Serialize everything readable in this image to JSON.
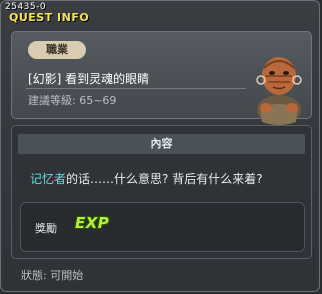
{
  "header": {
    "quest_id": "25435-0",
    "title": "QUEST INFO"
  },
  "info": {
    "job_tag": "職業",
    "quest_name": "[幻影] 看到灵魂的眼睛",
    "level_label": "建議等級: 65~69"
  },
  "npc": {
    "icon": "npc-portrait"
  },
  "content": {
    "heading": "內容",
    "dialogue_highlight": "记忆者",
    "dialogue_rest": "的话……什么意思? 背后有什么来着?"
  },
  "reward": {
    "label": "獎勵",
    "exp": "EXP"
  },
  "status": {
    "text": "狀態: 可開始"
  },
  "colors": {
    "title": "#f5e45a",
    "highlight": "#5fe0e0",
    "exp": "#b6f03a"
  }
}
